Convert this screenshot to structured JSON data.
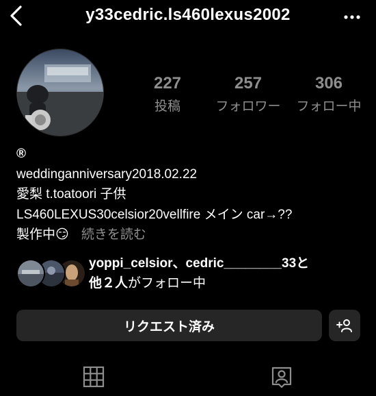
{
  "header": {
    "username": "y33cedric.ls460lexus2002",
    "back_icon": "chevron-left-icon",
    "more_icon": "more-horizontal-icon"
  },
  "stats": [
    {
      "value": "227",
      "label": "投稿"
    },
    {
      "value": "257",
      "label": "フォロワー"
    },
    {
      "value": "306",
      "label": "フォロー中"
    }
  ],
  "bio": {
    "name": "®",
    "line1": "weddinganniversary2018.02.22",
    "line2": "愛梨 t.toatoori 子供",
    "line3": "LS460LEXUS30celsior20vellfire メイン car→??",
    "line4": "製作中😏",
    "more_label": "続きを読む"
  },
  "followed_by": {
    "line1": "yoppi_celsior、cedric________33と",
    "bold_count": "他２人",
    "tail": "がフォロー中"
  },
  "actions": {
    "request_label": "リクエスト済み",
    "add_user_icon": "add-user-icon"
  },
  "tabs": [
    {
      "icon": "grid-icon"
    },
    {
      "icon": "tagged-user-icon"
    }
  ]
}
